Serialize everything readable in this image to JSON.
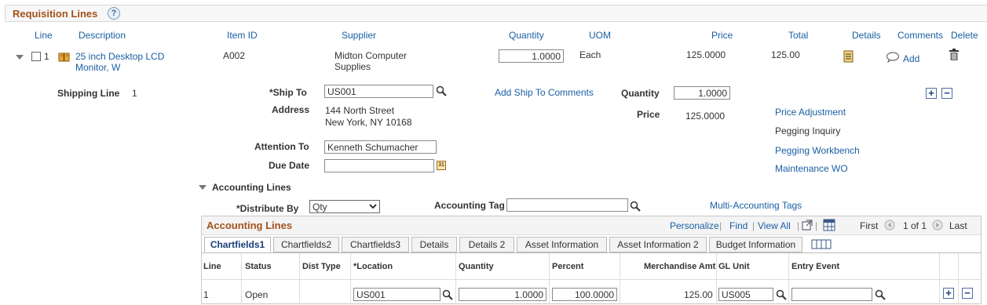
{
  "section": {
    "title": "Requisition Lines",
    "help": "?"
  },
  "columns": {
    "line": "Line",
    "description": "Description",
    "item_id": "Item ID",
    "supplier": "Supplier",
    "quantity": "Quantity",
    "uom": "UOM",
    "price": "Price",
    "total": "Total",
    "details": "Details",
    "comments": "Comments",
    "delete": "Delete"
  },
  "line": {
    "number": "1",
    "description_l1": "25 inch Desktop LCD",
    "description_l2": "Monitor, W",
    "item_id": "A002",
    "supplier_l1": "Midton Computer",
    "supplier_l2": "Supplies",
    "quantity": "1.0000",
    "uom": "Each",
    "price": "125.0000",
    "total": "125.00",
    "comments_add": "Add"
  },
  "shipping": {
    "label": "Shipping Line",
    "number": "1",
    "ship_to_label": "*Ship To",
    "ship_to": "US001",
    "add_comments": "Add Ship To Comments",
    "quantity_label": "Quantity",
    "quantity": "1.0000",
    "address_label": "Address",
    "address_l1": "144 North Street",
    "address_l2": "New York, NY  10168",
    "price_label": "Price",
    "price": "125.0000",
    "attention_label": "Attention To",
    "attention": "Kenneth Schumacher",
    "due_label": "Due Date",
    "due": "",
    "links": {
      "price_adjustment": "Price Adjustment",
      "pegging_inquiry": "Pegging Inquiry",
      "pegging_workbench": "Pegging Workbench",
      "maintenance_wo": "Maintenance WO"
    }
  },
  "accounting": {
    "heading": "Accounting Lines",
    "distribute_label": "*Distribute By",
    "distribute": "Qty",
    "tag_label": "Accounting Tag",
    "tag": "",
    "multi": "Multi-Accounting Tags",
    "grid_title": "Accounting Lines",
    "toolbar": {
      "personalize": "Personalize",
      "find": "Find",
      "view_all": "View All",
      "first": "First",
      "range": "1 of 1",
      "last": "Last"
    },
    "tabs": [
      "Chartfields1",
      "Chartfields2",
      "Chartfields3",
      "Details",
      "Details 2",
      "Asset Information",
      "Asset Information 2",
      "Budget Information"
    ],
    "grid_headers": {
      "line": "Line",
      "status": "Status",
      "dist_type": "Dist Type",
      "location": "*Location",
      "quantity": "Quantity",
      "percent": "Percent",
      "merch_amt": "Merchandise Amt",
      "gl_unit": "GL Unit",
      "entry_event": "Entry Event"
    },
    "row": {
      "line": "1",
      "status": "Open",
      "location": "US001",
      "quantity": "1.0000",
      "percent": "100.0000",
      "merch_amt": "125.00",
      "gl_unit": "US005",
      "entry_event": ""
    }
  }
}
